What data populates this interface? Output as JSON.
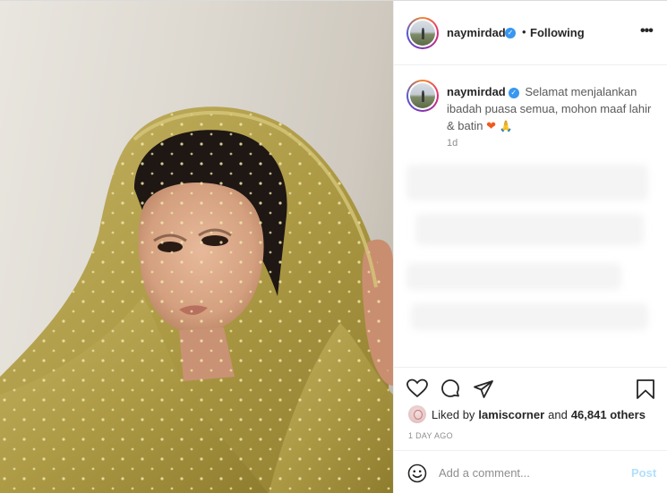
{
  "header": {
    "username": "naymirdad",
    "separator": "•",
    "follow_state": "Following",
    "more_icon": "more-horizontal-icon"
  },
  "caption": {
    "username": "naymirdad",
    "text": "Selamat menjalankan ibadah puasa semua, mohon maaf lahir & batin",
    "emoji_1": "❤",
    "emoji_2": "🙏",
    "relative_time": "1d"
  },
  "actions": {
    "like_icon": "heart-icon",
    "comment_icon": "comment-icon",
    "share_icon": "send-icon",
    "save_icon": "bookmark-icon"
  },
  "likes": {
    "prefix": "Liked by",
    "user": "lamiscorner",
    "conjunction": "and",
    "others": "46,841 others"
  },
  "timestamp": "1 DAY AGO",
  "comment": {
    "placeholder": "Add a comment...",
    "post_label": "Post",
    "emoji_icon": "smiley-icon"
  },
  "colors": {
    "verified": "#3897f0",
    "post_disabled": "#b2dffc",
    "veil": "#b8a44e"
  }
}
